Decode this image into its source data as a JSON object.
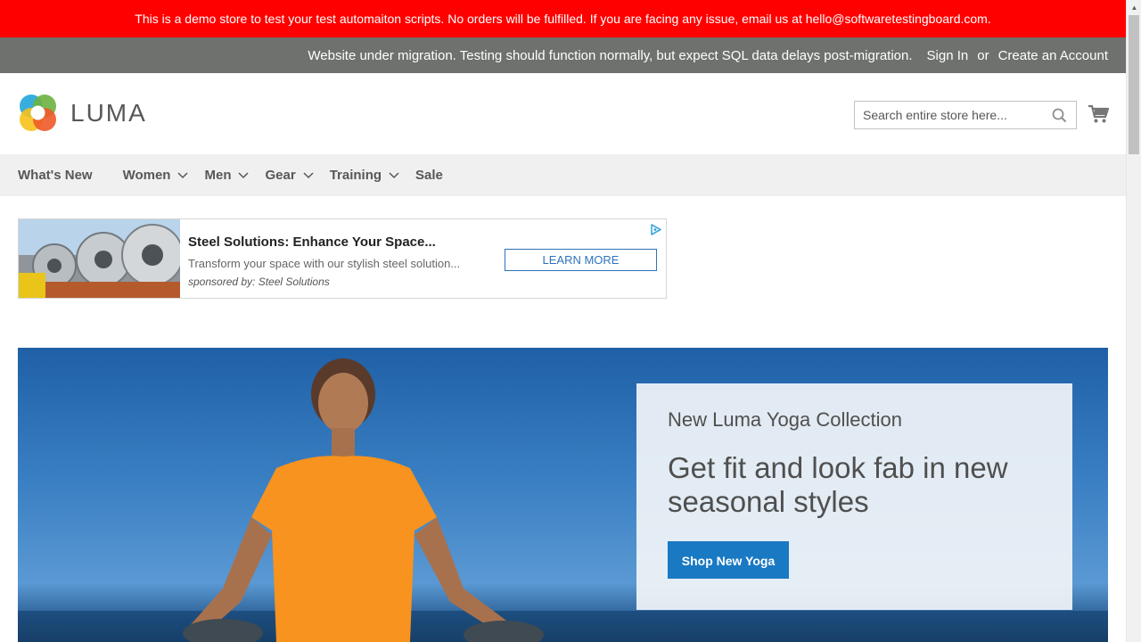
{
  "demo_notice": "This is a demo store to test your test automaiton scripts. No orders will be fulfilled. If you are facing any issue, email us at hello@softwaretestingboard.com.",
  "panel": {
    "notice": "Website under migration. Testing should function normally, but expect SQL data delays post-migration.",
    "sign_in": "Sign In",
    "or": "or",
    "create_account": "Create an Account"
  },
  "header": {
    "logo_text": "LUMA",
    "search_placeholder": "Search entire store here...",
    "search_value": "",
    "icons": [
      "search-icon",
      "cart-icon"
    ]
  },
  "nav": {
    "items": [
      {
        "label": "What's New",
        "has_submenu": false
      },
      {
        "label": "Women",
        "has_submenu": true
      },
      {
        "label": "Men",
        "has_submenu": true
      },
      {
        "label": "Gear",
        "has_submenu": true
      },
      {
        "label": "Training",
        "has_submenu": true
      },
      {
        "label": "Sale",
        "has_submenu": false
      }
    ]
  },
  "ad": {
    "title": "Steel Solutions: Enhance Your Space...",
    "description": "Transform your space with our stylish steel solution...",
    "sponsor": "sponsored by: Steel Solutions",
    "button": "LEARN MORE"
  },
  "hero": {
    "kicker": "New Luma Yoga Collection",
    "title": "Get fit and look fab in new seasonal styles",
    "button": "Shop New Yoga"
  },
  "colors": {
    "demo_bar": "#ff0000",
    "panel_bar": "#6e716e",
    "nav_bg": "#f0f0f0",
    "primary_button": "#1979c3",
    "ad_accent": "#2d73bc"
  }
}
